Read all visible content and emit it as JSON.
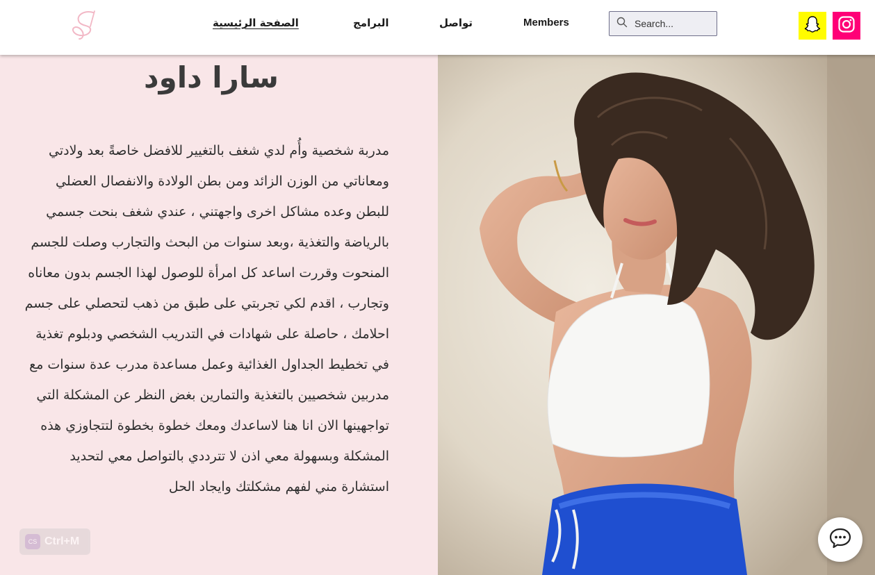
{
  "header": {
    "nav": {
      "home": "الصفحة الرئيسية",
      "programs": "البرامج",
      "contact": "تواصل",
      "members": "Members"
    },
    "search": {
      "placeholder": "Search..."
    },
    "social": [
      "snapchat-icon",
      "instagram-icon"
    ]
  },
  "main": {
    "title": "سارا داود",
    "bio": "مدربة شخصية وأُم لدي شغف بالتغيير للافضل خاصةً بعد ولادتي ومعاناتي من الوزن الزائد ومن بطن الولادة والانفصال العضلي للبطن وعده مشاكل اخرى واجهتني ، عندي شغف بنحت جسمي بالرياضة والتغذية ،وبعد سنوات من البحث والتجارب وصلت للجسم المنحوت وقررت اساعد كل امرأة للوصول لهذا الجسم بدون معاناه وتجارب ، اقدم لكي تجربتي على طبق من ذهب لتحصلي على جسم احلامك ، حاصلة على شهادات في التدريب الشخصي ودبلوم تغذية في تخطيط الجداول الغذائية وعمل مساعدة مدرب عدة سنوات مع مدربين شخصيين بالتغذية والتمارين بغض النظر عن المشكلة التي تواجهينها الان انا هنا لاساعدك ومعك خطوة بخطوة لتتجاوزي هذه المشكلة وبسهولة معي اذن لا تترددي بالتواصل معي لتحديد استشارة مني لفهم مشكلتك وايجاد الحل"
  },
  "overlay": {
    "shortcut_icon": "CS",
    "shortcut_label": "Ctrl+M"
  },
  "colors": {
    "panel_bg": "#F9E6E8",
    "snapchat": "#FFFC00",
    "instagram": "#FF0077",
    "logo_pink": "#F2B8C6"
  }
}
